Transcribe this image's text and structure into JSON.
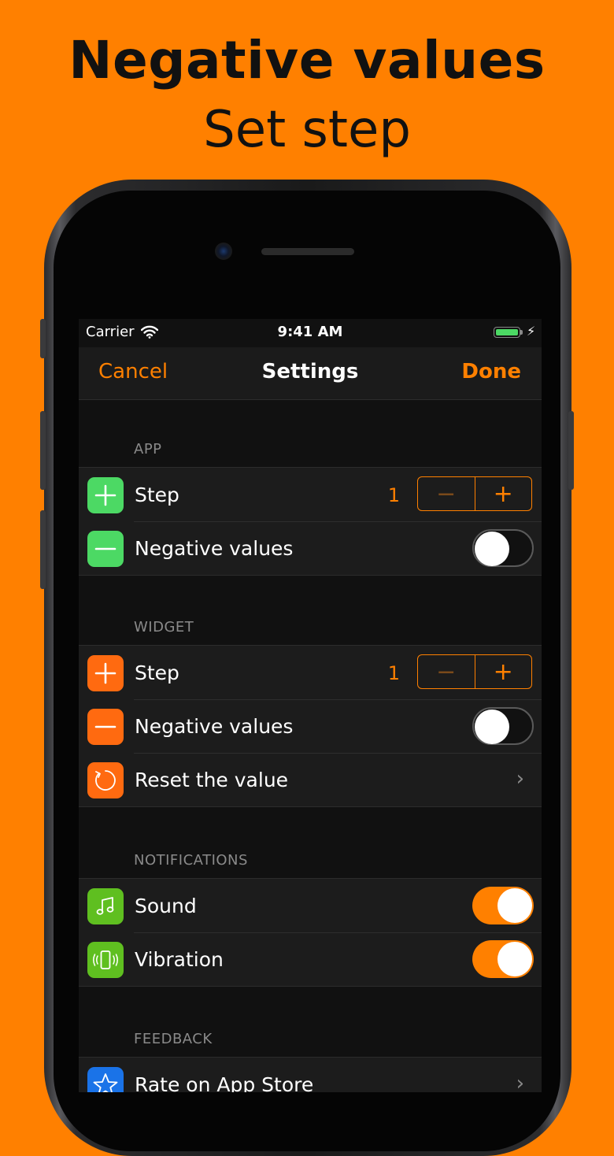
{
  "headline": {
    "title": "Negative values",
    "subtitle": "Set step"
  },
  "status_bar": {
    "carrier": "Carrier",
    "time": "9:41 AM"
  },
  "navbar": {
    "cancel_label": "Cancel",
    "title": "Settings",
    "done_label": "Done"
  },
  "sections": {
    "app": {
      "header": "APP",
      "step": {
        "label": "Step",
        "value": "1",
        "minus": "−",
        "plus": "+"
      },
      "negative": {
        "label": "Negative values",
        "enabled": false
      }
    },
    "widget": {
      "header": "WIDGET",
      "step": {
        "label": "Step",
        "value": "1",
        "minus": "−",
        "plus": "+"
      },
      "negative": {
        "label": "Negative values",
        "enabled": false
      },
      "reset": {
        "label": "Reset the value"
      }
    },
    "notifications": {
      "header": "NOTIFICATIONS",
      "sound": {
        "label": "Sound",
        "enabled": true
      },
      "vibration": {
        "label": "Vibration",
        "enabled": true
      }
    },
    "feedback": {
      "header": "FEEDBACK",
      "rate": {
        "label": "Rate on App Store"
      }
    }
  },
  "icons": {
    "plus": "plus-icon",
    "minus": "minus-icon",
    "reset": "refresh-icon",
    "sound": "music-note-icon",
    "vibration": "vibration-icon",
    "rate": "star-icon",
    "chevron": "chevron-right-icon"
  },
  "colors": {
    "background": "#ff8000",
    "accent": "#ff8000",
    "green": "#4cd964",
    "orange": "#ff6a10",
    "lime": "#5fbf20",
    "blue": "#1a73e8"
  }
}
